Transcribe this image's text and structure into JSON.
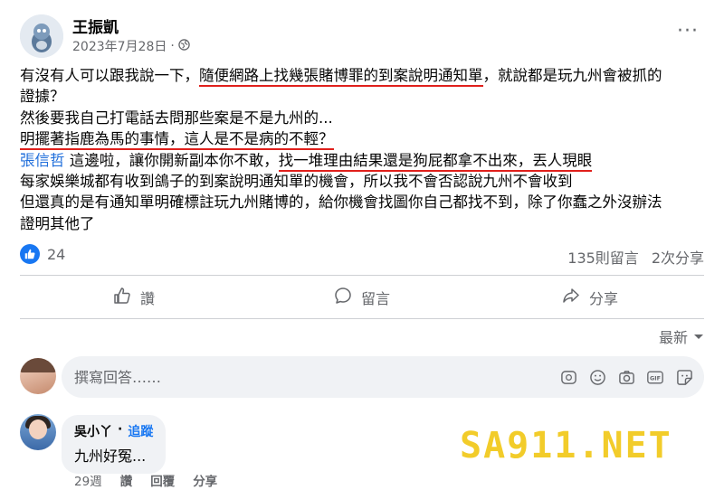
{
  "post": {
    "author": "王振凱",
    "date": "2023年7月28日",
    "audience_icon": "globe-icon",
    "more_icon": "more-dots-icon",
    "lines": [
      {
        "pre": "有沒有人可以跟我說一下，",
        "hl": "隨便網路上找幾張賭博罪的到案說明通知單",
        "post": "，就說都是玩九州會被抓的"
      },
      {
        "text": "證據？"
      },
      {
        "text": "然後要我自己打電話去問那些案是不是九州的..."
      },
      {
        "hl": "明擺著指鹿為馬的事情，這人是不是病的不輕？"
      },
      {
        "mention": "張信哲",
        "mid": " 這邊啦，讓你開新副本你不敢，",
        "hl": "找一堆理由結果還是狗屁都拿不出來，丟人現眼"
      },
      {
        "text": "每家娛樂城都有收到鴿子的到案說明通知單的機會，所以我不會否認說九州不會收到"
      },
      {
        "text": "但還真的是有通知單明確標註玩九州賭博的，給你機會找圖你自己都找不到，除了你蠢之外沒辦法"
      },
      {
        "text": "證明其他了"
      }
    ]
  },
  "reactions": {
    "count": "24",
    "icon": "like-icon"
  },
  "stats": {
    "comments": "135則留言",
    "shares": "2次分享"
  },
  "actions": {
    "like": "讚",
    "comment": "留言",
    "share": "分享"
  },
  "sort": {
    "label": "最新",
    "icon": "caret-down-icon"
  },
  "composer": {
    "placeholder": "撰寫回答……"
  },
  "comment": {
    "author": "吳小丫",
    "separator": "·",
    "follow": "追蹤",
    "text": "九州好冤...",
    "time": "29週",
    "like": "讚",
    "reply": "回覆",
    "share": "分享"
  },
  "watermark": "SA911.NET",
  "colors": {
    "underline": "#e0201c",
    "link": "#216fdb",
    "facebook_blue": "#1877f2",
    "watermark": "#f2cc2a"
  }
}
